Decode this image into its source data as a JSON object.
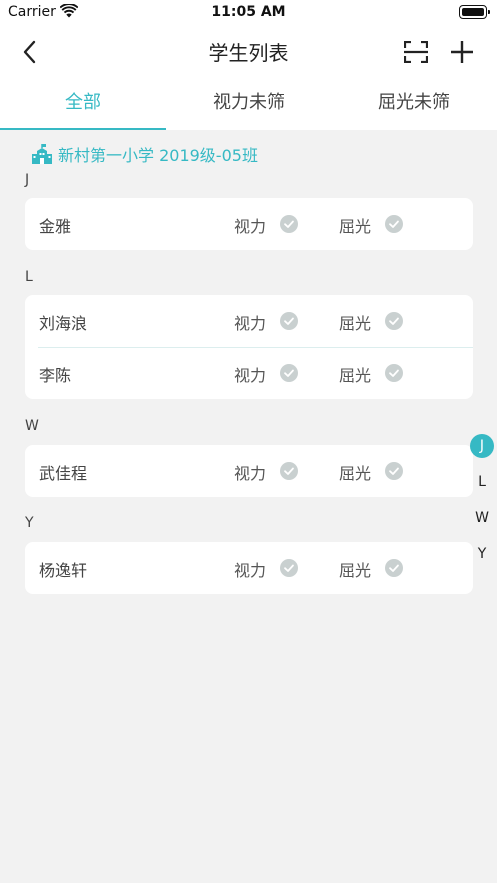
{
  "status_bar": {
    "carrier": "Carrier",
    "time": "11:05 AM"
  },
  "nav": {
    "title": "学生列表"
  },
  "tabs": [
    {
      "label": "全部",
      "active": true
    },
    {
      "label": "视力未筛",
      "active": false
    },
    {
      "label": "屈光未筛",
      "active": false
    }
  ],
  "school": {
    "name": "新村第一小学 2019级-05班"
  },
  "groups": [
    {
      "letter": "J",
      "students": [
        {
          "name": "金雅",
          "vision": "视力",
          "refraction": "屈光"
        }
      ]
    },
    {
      "letter": "L",
      "students": [
        {
          "name": "刘海浪",
          "vision": "视力",
          "refraction": "屈光"
        },
        {
          "name": "李陈",
          "vision": "视力",
          "refraction": "屈光"
        }
      ]
    },
    {
      "letter": "W",
      "students": [
        {
          "name": "武佳程",
          "vision": "视力",
          "refraction": "屈光"
        }
      ]
    },
    {
      "letter": "Y",
      "students": [
        {
          "name": "杨逸轩",
          "vision": "视力",
          "refraction": "屈光"
        }
      ]
    }
  ],
  "index_bar": [
    "J",
    "L",
    "W",
    "Y"
  ],
  "colors": {
    "accent": "#36b9c4",
    "check_gray": "#c9d0d0",
    "background": "#f2f2f2"
  },
  "icons": {
    "back": "chevron-left-icon",
    "scan": "scan-icon",
    "add": "plus-icon",
    "school": "school-building-icon",
    "check": "check-circle-icon",
    "wifi": "wifi-icon",
    "battery": "battery-icon"
  }
}
